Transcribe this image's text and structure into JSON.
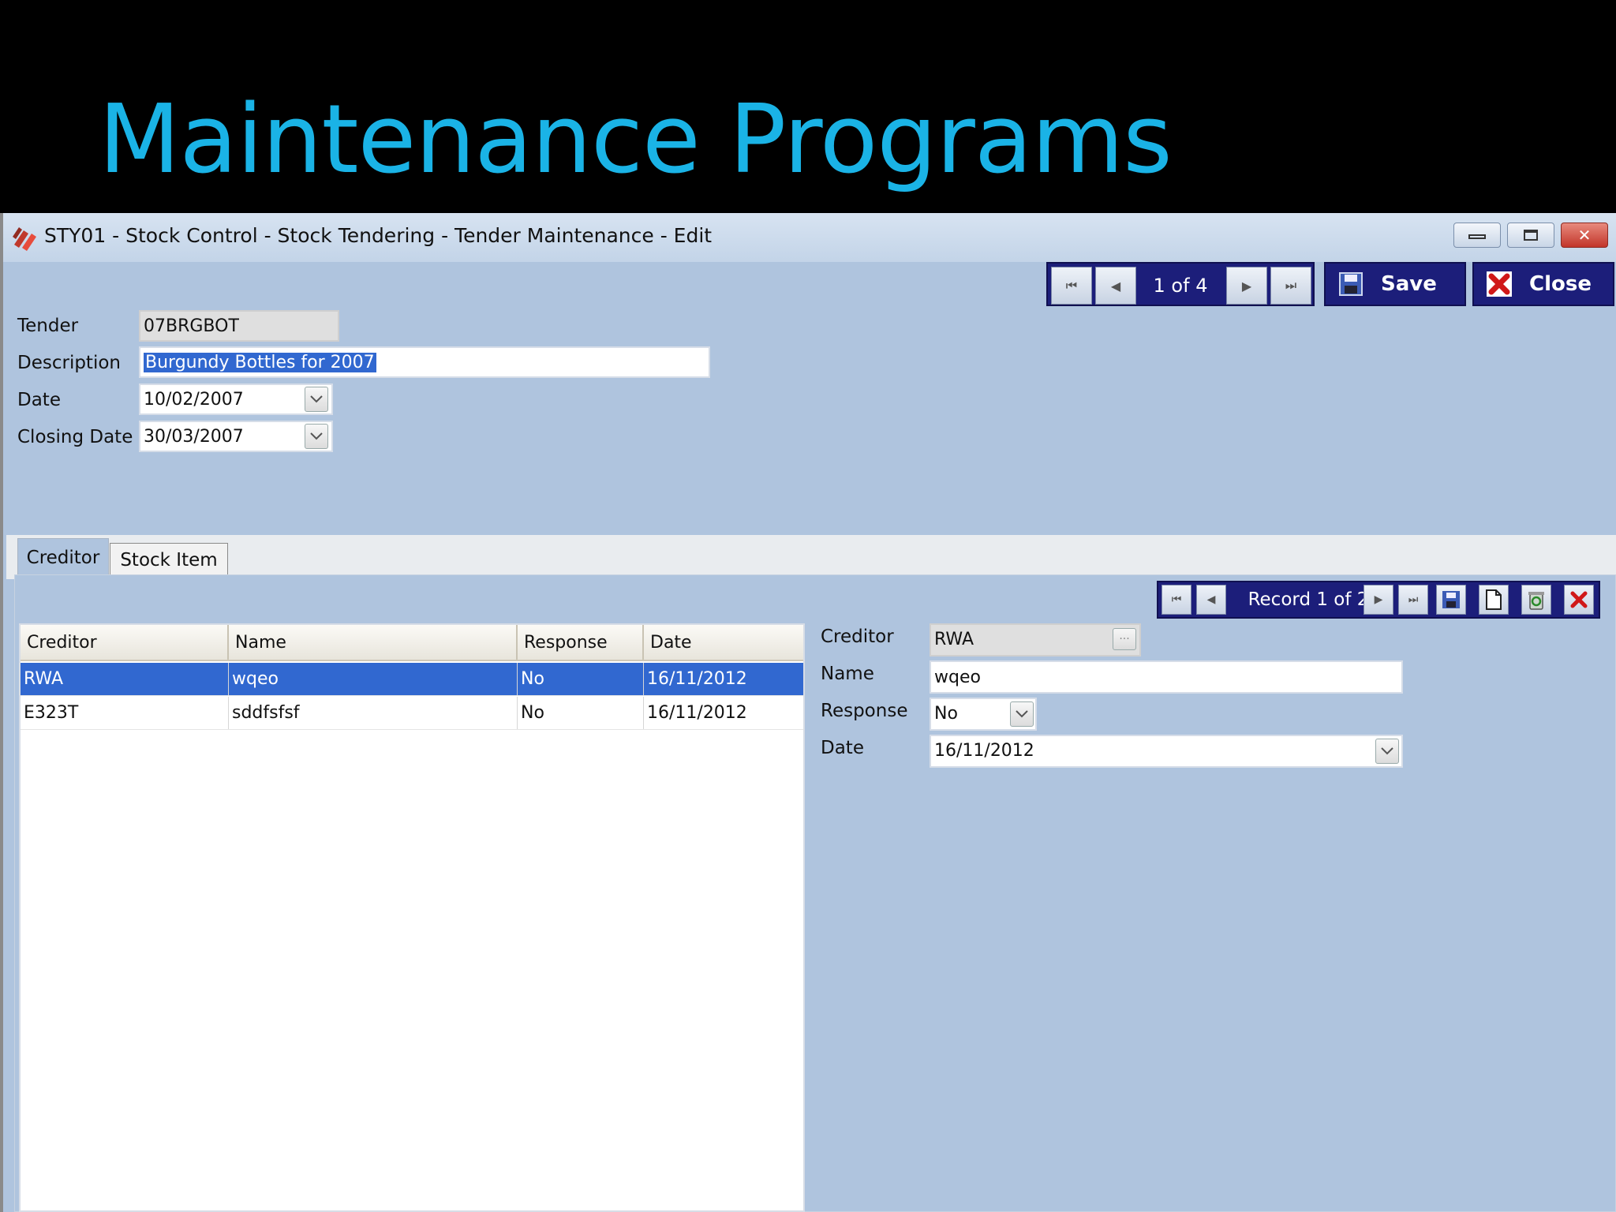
{
  "slide": {
    "title": "Maintenance Programs"
  },
  "window": {
    "title": "STY01 - Stock Control - Stock Tendering -  Tender Maintenance - Edit",
    "controls": {
      "minimize": "▭",
      "restore": "◻",
      "close": "✕"
    }
  },
  "top_nav": {
    "first": "⏮",
    "prev": "◀",
    "next": "▶",
    "last": "⏭",
    "position": "1 of 4",
    "save_label": "Save",
    "close_label": "Close"
  },
  "form": {
    "tender": {
      "label": "Tender",
      "value": "07BRGBOT"
    },
    "description": {
      "label": "Description",
      "value": "Burgundy Bottles for 2007"
    },
    "date": {
      "label": "Date",
      "value": "10/02/2007"
    },
    "closing_date": {
      "label": "Closing Date",
      "value": "30/03/2007"
    }
  },
  "tabs": [
    {
      "label": "Creditor",
      "active": true
    },
    {
      "label": "Stock Item",
      "active": false
    }
  ],
  "sub_nav": {
    "position": "Record 1 of 2",
    "first": "⏮",
    "prev": "◀",
    "next": "▶",
    "last": "⏭"
  },
  "grid": {
    "columns": [
      "Creditor",
      "Name",
      "Response",
      "Date"
    ],
    "rows": [
      {
        "creditor": "RWA",
        "name": "wqeo",
        "response": "No",
        "date": "16/11/2012",
        "selected": true
      },
      {
        "creditor": "E323T",
        "name": "sddfsfsf",
        "response": "No",
        "date": "16/11/2012",
        "selected": false
      }
    ]
  },
  "detail": {
    "creditor": {
      "label": "Creditor",
      "value": "RWA",
      "lookup": "···"
    },
    "name": {
      "label": "Name",
      "value": "wqeo"
    },
    "response": {
      "label": "Response",
      "value": "No"
    },
    "date": {
      "label": "Date",
      "value": "16/11/2012"
    }
  },
  "colors": {
    "accent": "#1c1e7a",
    "selection": "#3168d0",
    "background": "#afc4de",
    "title": "#1ab3e6"
  }
}
